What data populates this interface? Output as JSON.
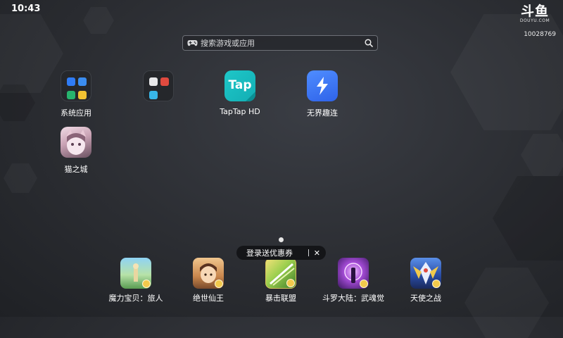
{
  "status": {
    "time": "10:43"
  },
  "brand": {
    "logo_text": "斗鱼",
    "logo_sub": "DOUYU.COM",
    "room_id": "10028769"
  },
  "search": {
    "placeholder": "搜索游戏或应用"
  },
  "apps": [
    {
      "label": "系统应用",
      "icon": "folder-icon"
    },
    {
      "label": "",
      "icon": "folder-icon"
    },
    {
      "label": "TapTap HD",
      "icon": "taptap-icon",
      "icon_text": "Tap"
    },
    {
      "label": "无界趣连",
      "icon": "wujie-icon"
    },
    {
      "label": "猫之城",
      "icon": "cat-city-icon"
    }
  ],
  "promo": {
    "text": "登录送优惠券",
    "close": "✕"
  },
  "dock": [
    {
      "label": "魔力宝贝：旅人",
      "icon": "game-icon"
    },
    {
      "label": "绝世仙王",
      "icon": "game-icon"
    },
    {
      "label": "暴击联盟",
      "icon": "game-icon"
    },
    {
      "label": "斗罗大陆：武魂觉",
      "icon": "game-icon"
    },
    {
      "label": "天使之战",
      "icon": "game-icon"
    }
  ],
  "colors": {
    "accent_tap": "#1ec7c8",
    "accent_wujie": "#3f78f5",
    "background": "#2b2d32"
  }
}
